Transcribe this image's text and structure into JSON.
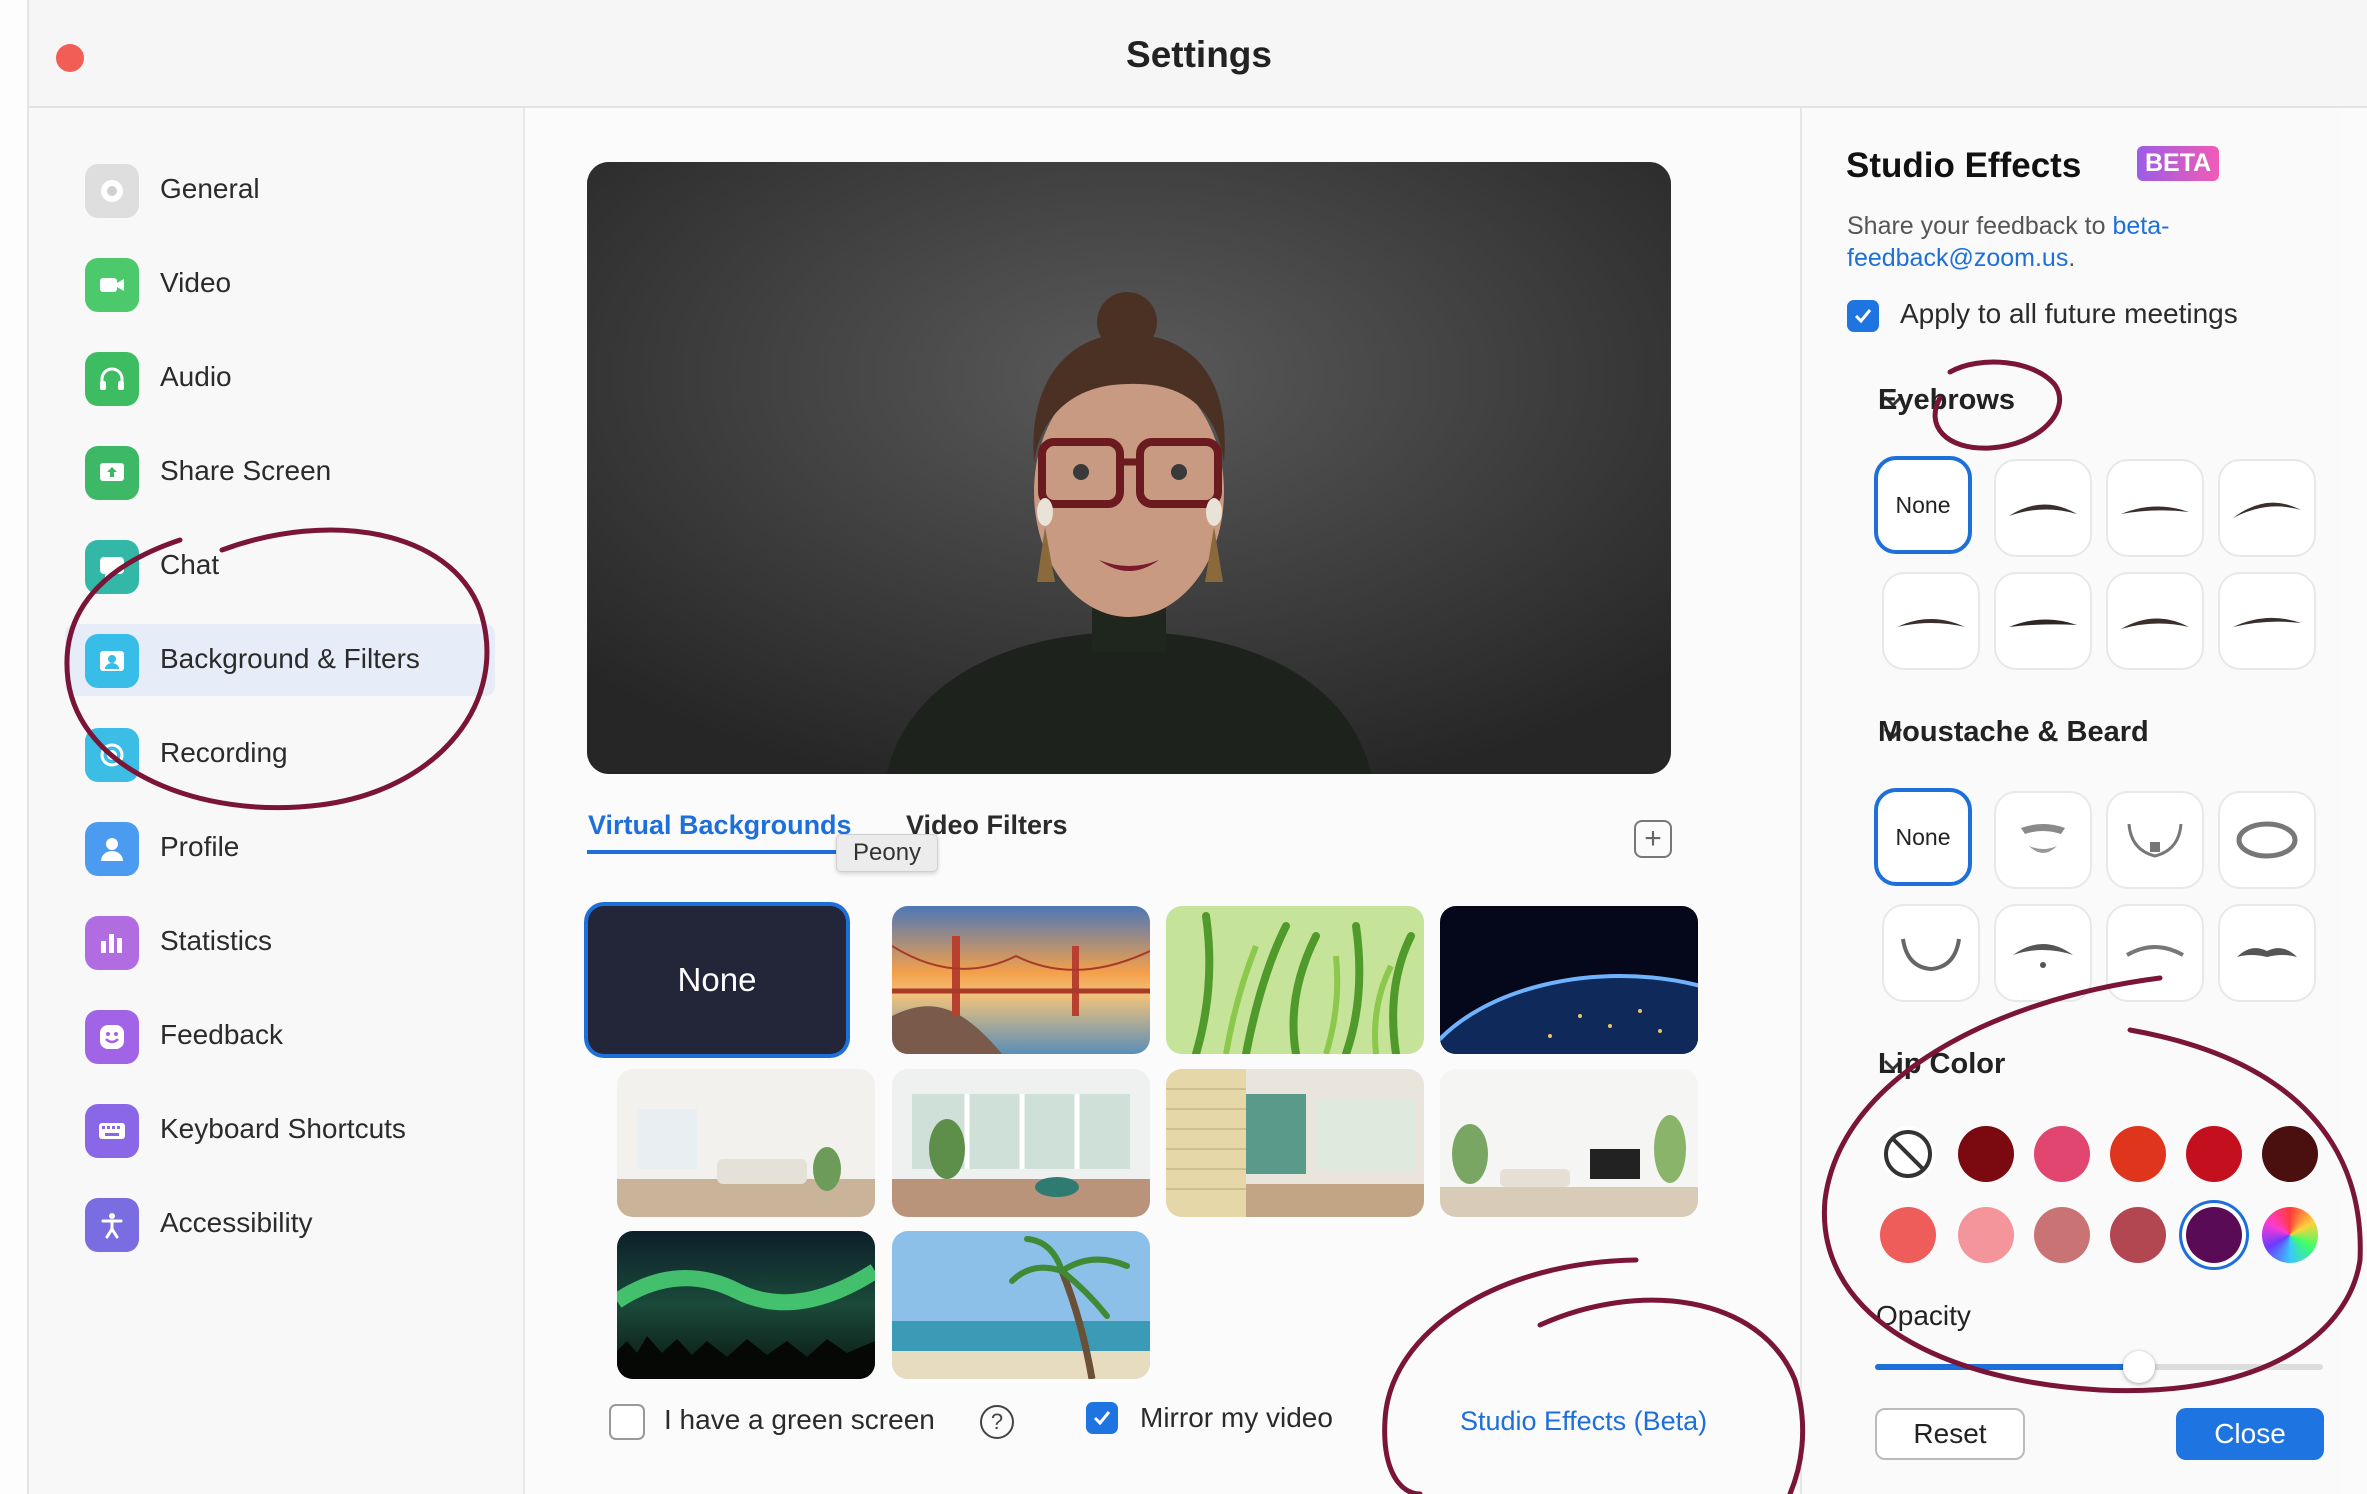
{
  "window": {
    "title": "Settings"
  },
  "sidebar": {
    "items": [
      {
        "label": "General",
        "icon": "gear-icon",
        "color": "#d9d9d9"
      },
      {
        "label": "Video",
        "icon": "video-camera-icon",
        "color": "#4cc96b"
      },
      {
        "label": "Audio",
        "icon": "headphones-icon",
        "color": "#3ebc62"
      },
      {
        "label": "Share Screen",
        "icon": "share-screen-icon",
        "color": "#3cb867"
      },
      {
        "label": "Chat",
        "icon": "chat-bubble-icon",
        "color": "#33b8a7"
      },
      {
        "label": "Background & Filters",
        "icon": "background-icon",
        "color": "#38bde8"
      },
      {
        "label": "Recording",
        "icon": "record-icon",
        "color": "#3bbde6"
      },
      {
        "label": "Profile",
        "icon": "person-icon",
        "color": "#4b9cf0"
      },
      {
        "label": "Statistics",
        "icon": "bar-chart-icon",
        "color": "#b06ce0"
      },
      {
        "label": "Feedback",
        "icon": "smiley-icon",
        "color": "#a264e6"
      },
      {
        "label": "Keyboard Shortcuts",
        "icon": "keyboard-icon",
        "color": "#8a67e6"
      },
      {
        "label": "Accessibility",
        "icon": "accessibility-icon",
        "color": "#7a6de2"
      }
    ],
    "active_item": "Background & Filters"
  },
  "main": {
    "tabs": [
      {
        "label": "Virtual Backgrounds",
        "active": true
      },
      {
        "label": "Video Filters",
        "active": false
      }
    ],
    "tooltip": "Peony",
    "backgrounds": {
      "none_label": "None",
      "items": [
        "golden-gate-bridge",
        "grass",
        "earth-from-space",
        "white-living-room",
        "sunroom-living-room",
        "brick-patio-room",
        "white-lounge",
        "aurora",
        "palm-beach"
      ]
    },
    "green_screen": {
      "label": "I have a green screen",
      "checked": false
    },
    "mirror_video": {
      "label": "Mirror my video",
      "checked": true
    },
    "studio_effects_link": "Studio Effects (Beta)"
  },
  "studio_effects": {
    "title": "Studio Effects",
    "badge": "BETA",
    "feedback_prefix": "Share your feedback to ",
    "feedback_email": "beta-feedback@zoom.us",
    "feedback_suffix": ".",
    "apply_all": {
      "label": "Apply to all future meetings",
      "checked": true
    },
    "eyebrows": {
      "label": "Eyebrows",
      "none_label": "None"
    },
    "moustache": {
      "label": "Moustache & Beard",
      "none_label": "None"
    },
    "lip_color": {
      "label": "Lip Color",
      "colors": [
        "#7a0a0f",
        "#e0466f",
        "#e0351d",
        "#c4101e",
        "#4a1010",
        "#ee5d5a",
        "#f3959a",
        "#c97375",
        "#b24752",
        "#5a0b55"
      ]
    },
    "opacity": {
      "label": "Opacity",
      "value": 0.59
    },
    "buttons": {
      "reset": "Reset",
      "close": "Close"
    }
  },
  "colors": {
    "accent": "#1d6fd9",
    "annotation": "#7a1538"
  }
}
